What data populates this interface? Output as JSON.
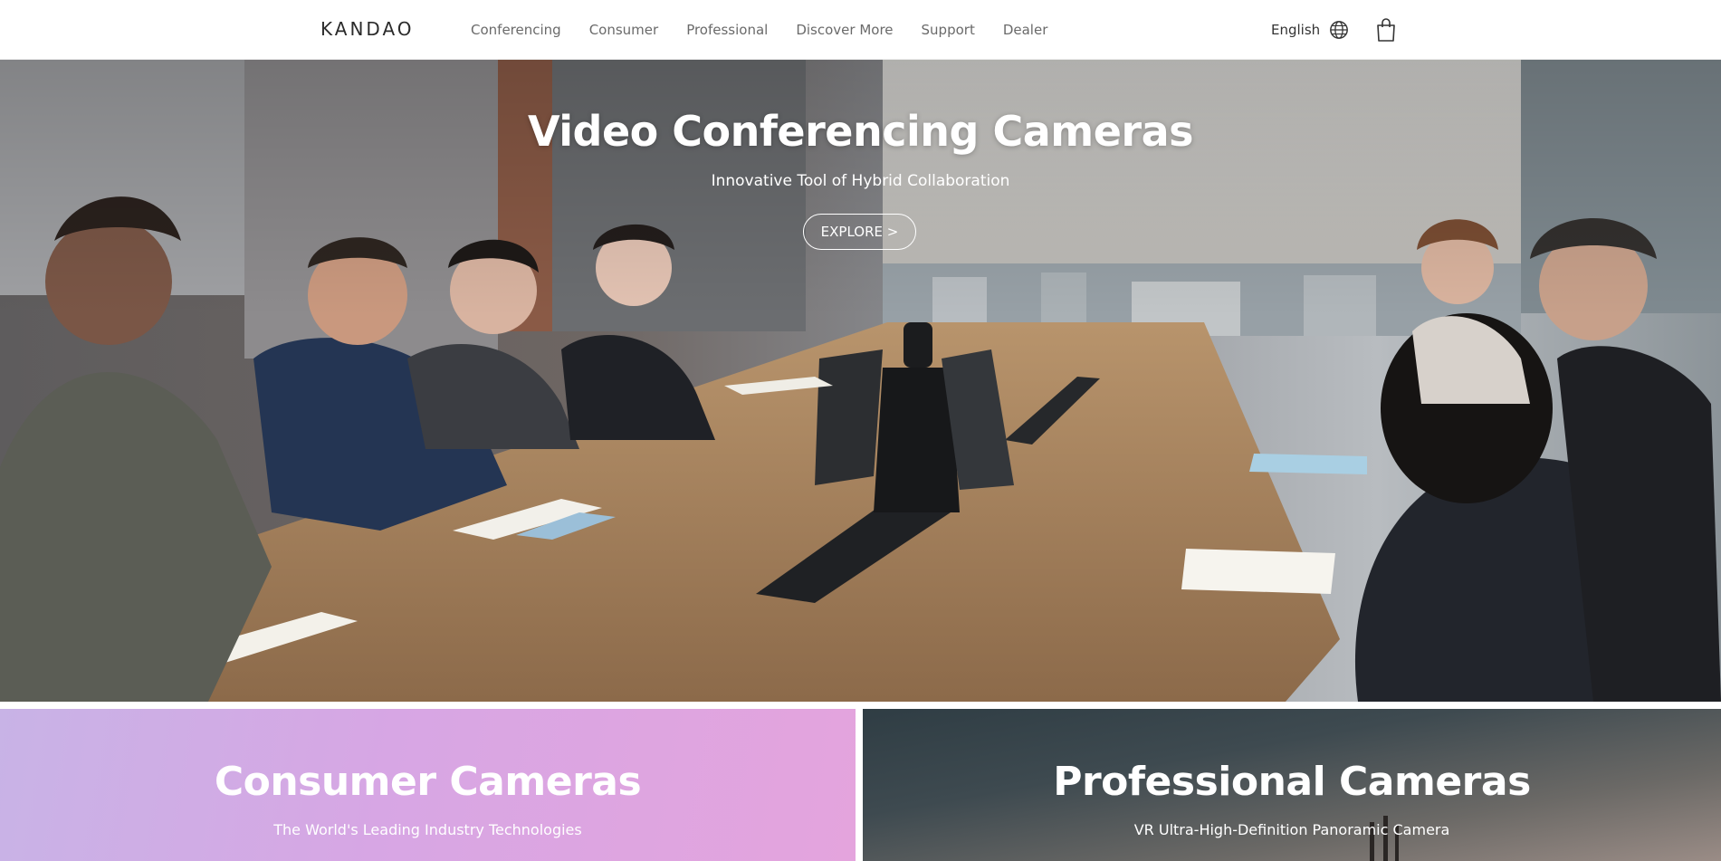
{
  "header": {
    "logo": "KANDAO",
    "nav": [
      "Conferencing",
      "Consumer",
      "Professional",
      "Discover More",
      "Support",
      "Dealer"
    ],
    "language": "English",
    "globe_icon": "globe-icon",
    "cart_icon": "shopping-bag-icon"
  },
  "hero": {
    "title": "Video Conferencing Cameras",
    "subtitle": "Innovative Tool of Hybrid Collaboration",
    "cta": "EXPLORE >"
  },
  "tiles": [
    {
      "title": "Consumer Cameras",
      "subtitle": "The World's Leading Industry Technologies"
    },
    {
      "title": "Professional Cameras",
      "subtitle": "VR Ultra-High-Definition Panoramic Camera"
    }
  ],
  "colors": {
    "header_bg": "#ffffff",
    "nav_text": "#6a6a6a",
    "consumer_gradient_start": "#c8b3e6",
    "consumer_gradient_end": "#e4a4dd",
    "pro_gradient_start": "#2f3d44",
    "pro_gradient_end": "#9a8c86"
  }
}
